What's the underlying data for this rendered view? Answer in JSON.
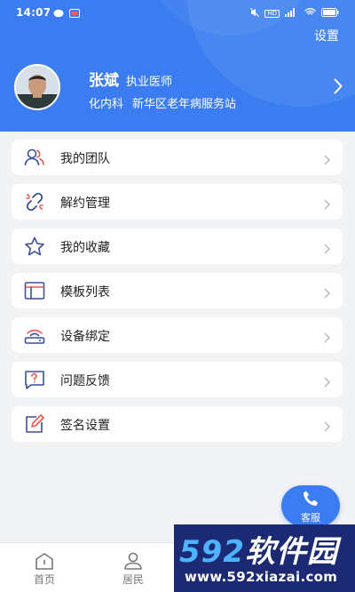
{
  "status_bar": {
    "time": "14:07",
    "battery": "100",
    "network": "5G"
  },
  "header": {
    "settings_label": "设置"
  },
  "profile": {
    "name": "张斌",
    "title": "执业医师",
    "department": "化内科",
    "organization": "新华区老年病服务站"
  },
  "menu": [
    {
      "label": "我的团队",
      "icon": "team-icon"
    },
    {
      "label": "解约管理",
      "icon": "unlink-icon"
    },
    {
      "label": "我的收藏",
      "icon": "star-icon"
    },
    {
      "label": "模板列表",
      "icon": "template-icon"
    },
    {
      "label": "设备绑定",
      "icon": "router-icon"
    },
    {
      "label": "问题反馈",
      "icon": "feedback-icon"
    },
    {
      "label": "签名设置",
      "icon": "signature-edit-icon"
    }
  ],
  "service": {
    "label": "客服"
  },
  "bottom_nav": [
    {
      "label": "首页",
      "icon": "home-icon"
    },
    {
      "label": "居民",
      "icon": "resident-icon"
    }
  ],
  "watermark": {
    "brand_num": "592",
    "brand_text": "软件园",
    "url": "www.592xiazai.com"
  },
  "colors": {
    "primary": "#3b7df0",
    "background": "#f2f3f5",
    "watermark_bg": "#1b2a72"
  }
}
